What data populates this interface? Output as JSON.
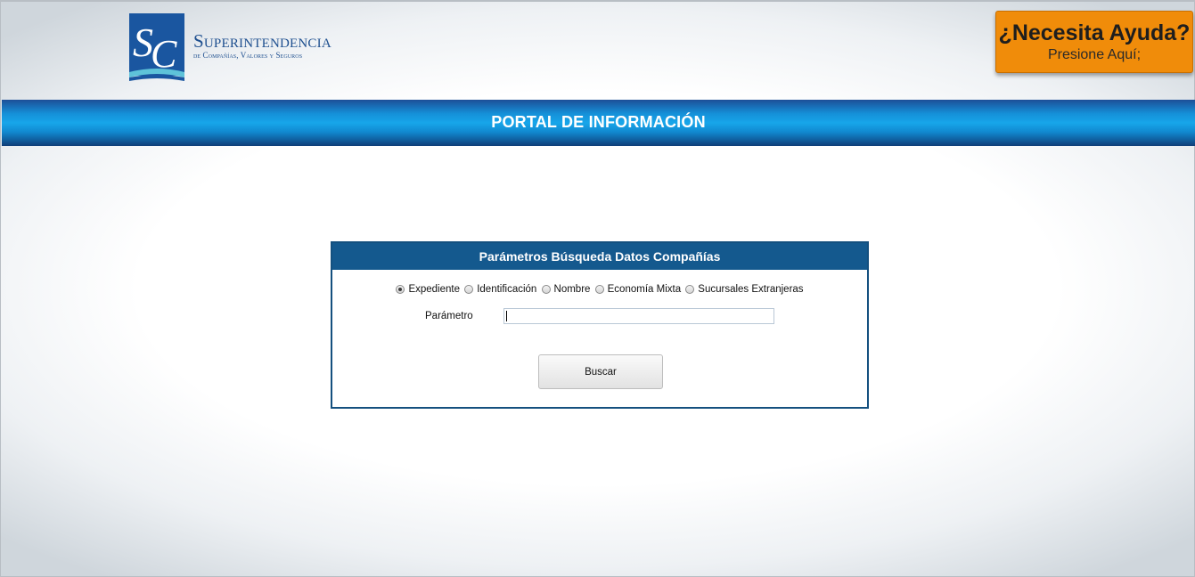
{
  "header": {
    "logo": {
      "monogram": "SC",
      "name": "Superintendencia",
      "subtitle": "de Compañías, Valores y Seguros"
    },
    "help": {
      "title": "¿Necesita Ayuda?",
      "subtitle": "Presione Aquí;"
    }
  },
  "banner": {
    "title": "PORTAL DE INFORMACIÓN"
  },
  "search_panel": {
    "title": "Parámetros Búsqueda Datos Compañías",
    "options": [
      {
        "label": "Expediente",
        "selected": true
      },
      {
        "label": "Identificación",
        "selected": false
      },
      {
        "label": "Nombre",
        "selected": false
      },
      {
        "label": "Economía Mixta",
        "selected": false
      },
      {
        "label": "Sucursales Extranjeras",
        "selected": false
      }
    ],
    "parameter_label": "Parámetro",
    "parameter_value": "",
    "search_button": "Buscar"
  },
  "colors": {
    "brand_blue": "#14598e",
    "help_orange": "#f08c0a",
    "banner_blue": "#17a6ea"
  }
}
